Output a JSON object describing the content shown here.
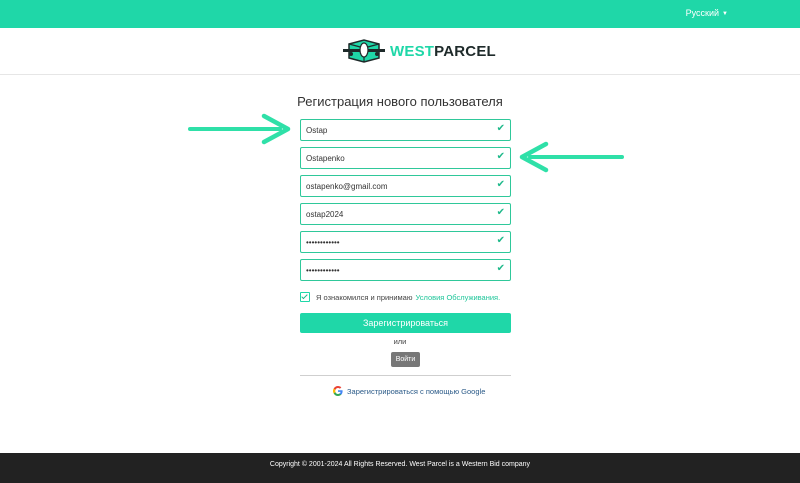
{
  "topbar": {
    "language": "Русский",
    "accent_color": "#1fd7a8"
  },
  "logo": {
    "part1": "WEST",
    "part2": "PARCEL"
  },
  "form": {
    "title": "Регистрация нового пользователя",
    "fields": [
      {
        "name": "first-name",
        "value": "Ostap"
      },
      {
        "name": "last-name",
        "value": "Ostapenko"
      },
      {
        "name": "email",
        "value": "ostapenko@gmail.com"
      },
      {
        "name": "username",
        "value": "ostap2024"
      },
      {
        "name": "password",
        "value": "••••••••••••"
      },
      {
        "name": "password-confirm",
        "value": "••••••••••••"
      }
    ],
    "terms_text": "Я ознакомился и принимаю",
    "terms_link": "Условия Обслуживания.",
    "submit_label": "Зарегистрироваться",
    "or_text": "или",
    "login_label": "Войти",
    "google_label": "Зарегистрироваться с помощью Google"
  },
  "footer": {
    "text": "Copyright © 2001-2024 All Rights Reserved. West Parcel is a Western Bid company"
  }
}
